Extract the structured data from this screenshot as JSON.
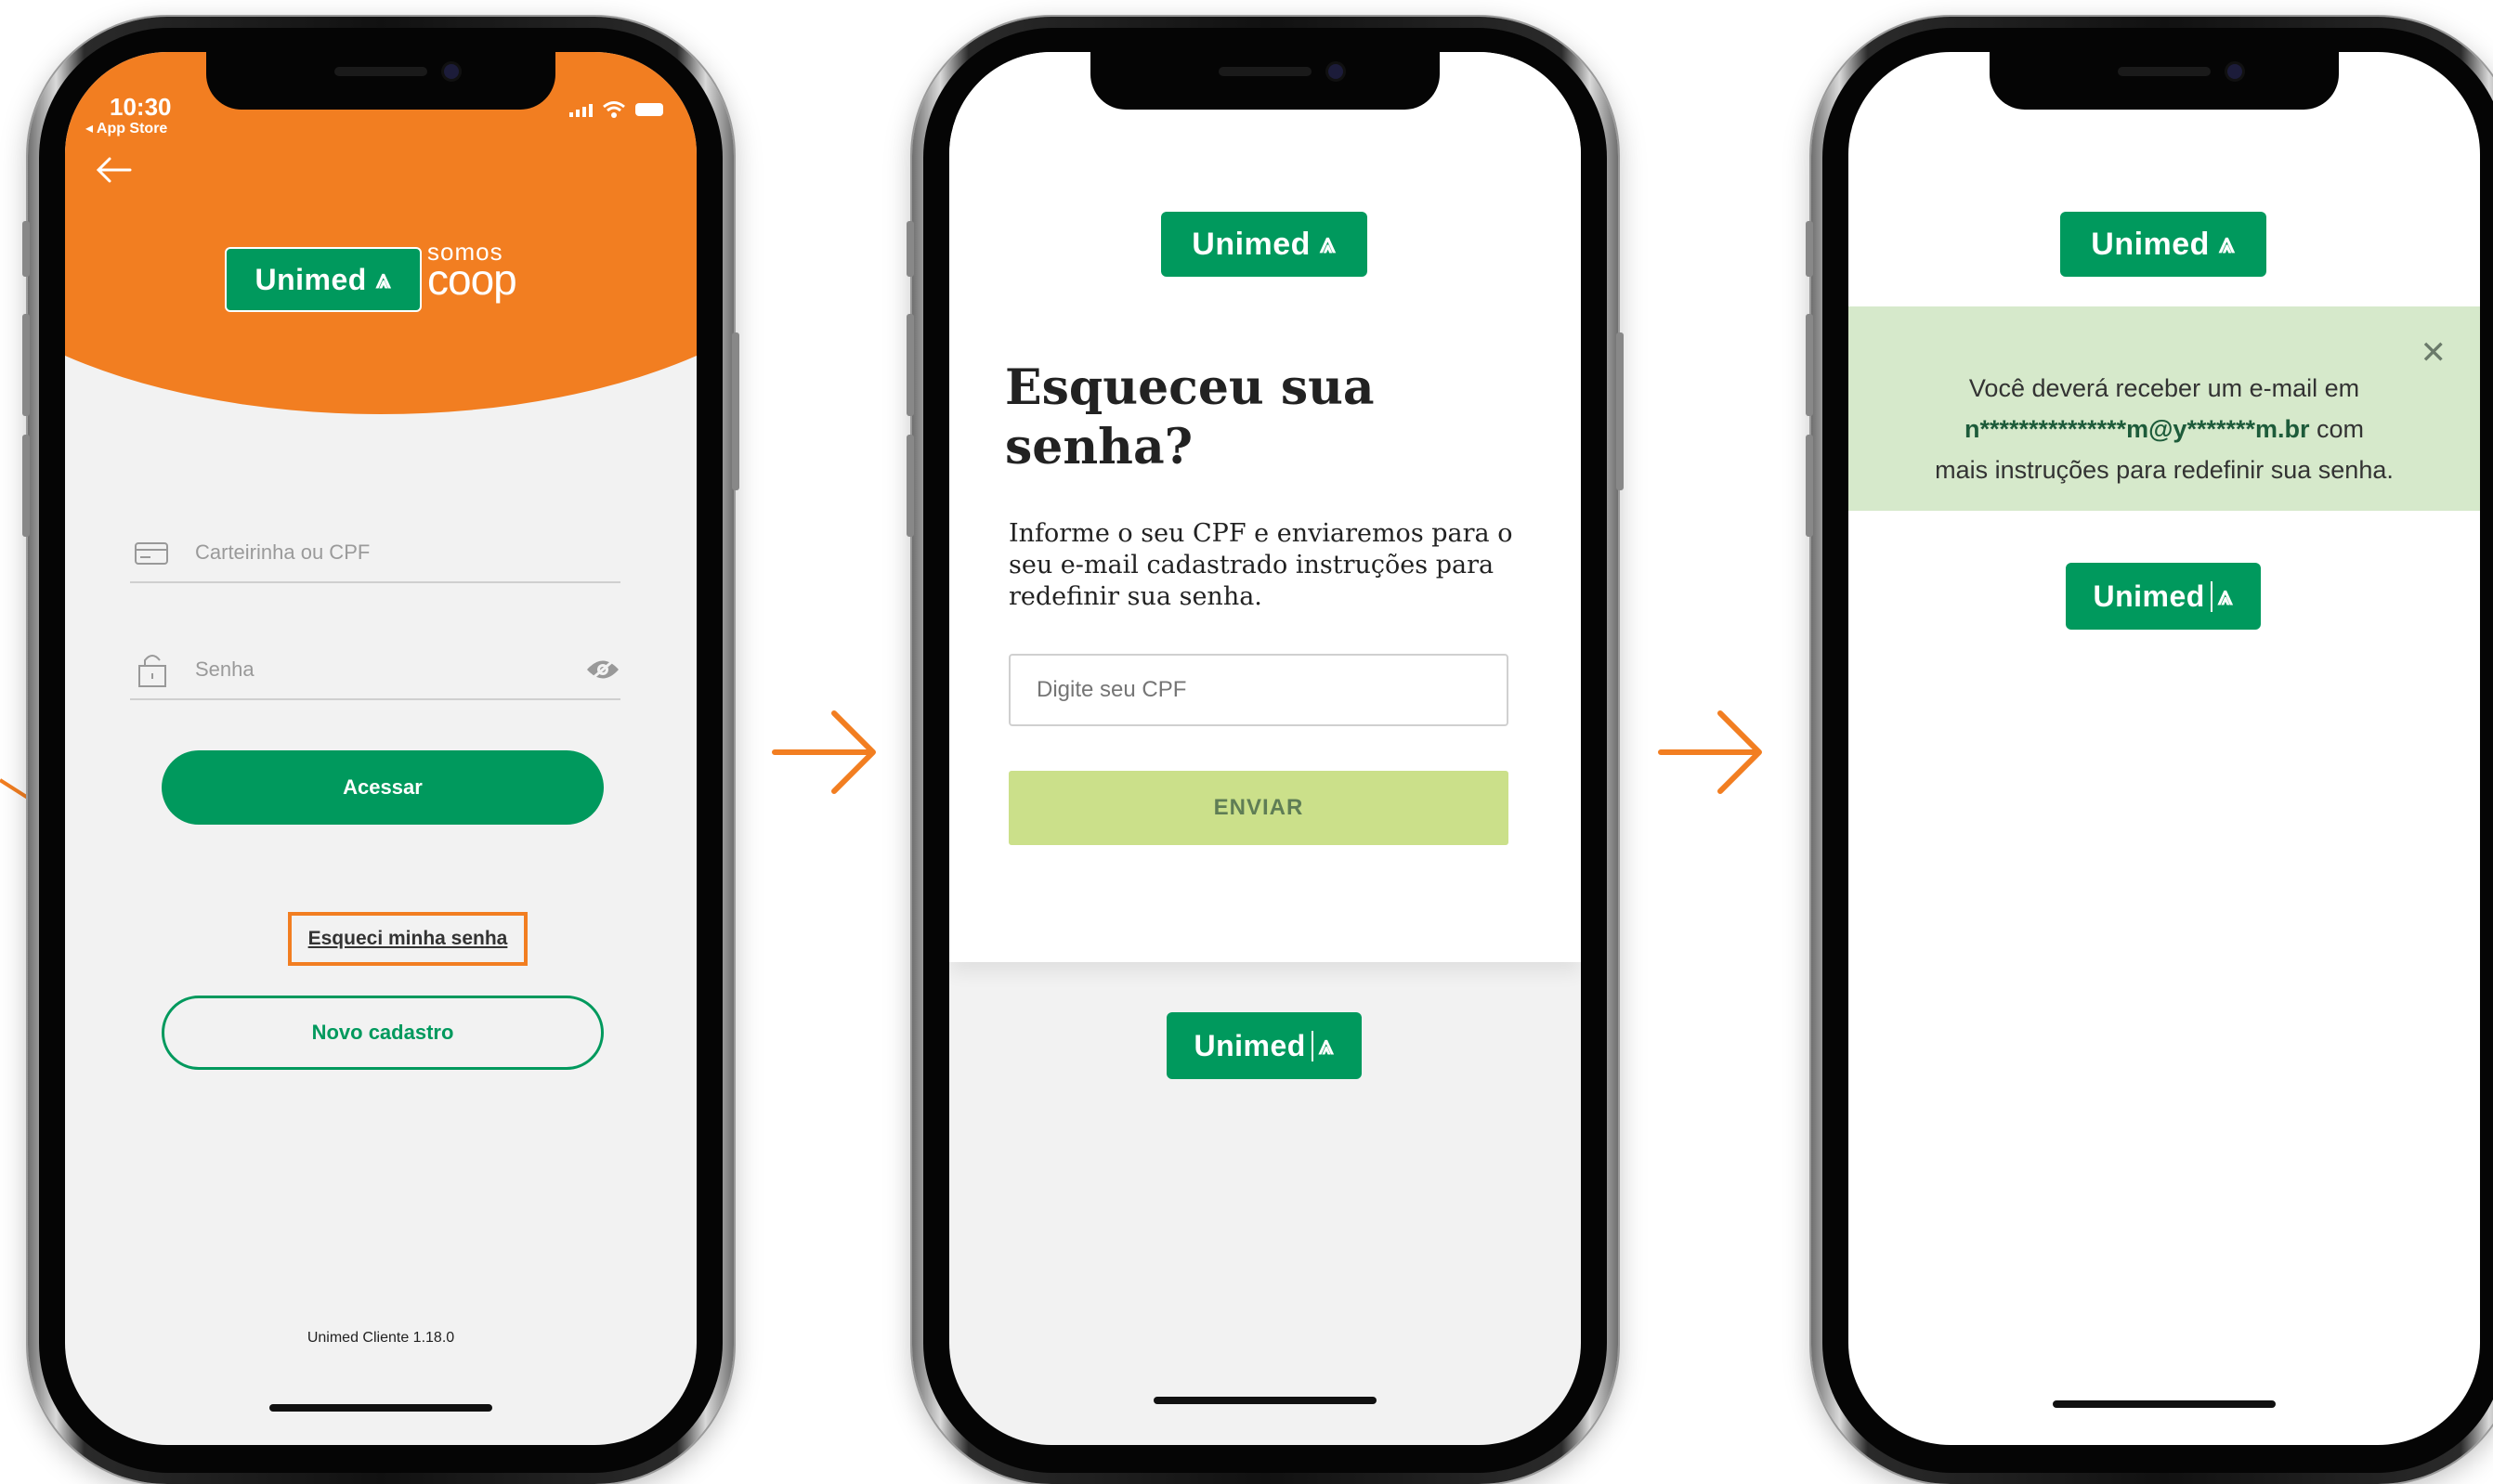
{
  "colors": {
    "brand_green": "#00995d",
    "orange": "#f27e21",
    "disabled_button": "#cbe08a",
    "success_bg": "#d6e9cb"
  },
  "login_screen": {
    "status_time": "10:30",
    "status_back": "◂ App Store",
    "logo_text": "Unimed",
    "somos_top": "somos",
    "somos_bottom": "coop",
    "card_field_placeholder": "Carteirinha ou CPF",
    "password_placeholder": "Senha",
    "access_button": "Acessar",
    "forgot_link": "Esqueci minha senha",
    "register_button": "Novo cadastro",
    "version": "Unimed Cliente 1.18.0"
  },
  "forgot_screen": {
    "logo_text": "Unimed",
    "title": "Esqueceu sua senha?",
    "description": "Informe o seu CPF e enviaremos para o seu e-mail cadastrado instruções para redefinir sua senha.",
    "cpf_placeholder": "Digite seu CPF",
    "send_button": "ENVIAR",
    "footer_logo_text": "Unimed"
  },
  "success_screen": {
    "logo_text": "Unimed",
    "message_line1": "Você deverá receber um e-mail em",
    "masked_email": "n***************m@y*******m.br",
    "message_with": " com",
    "message_line3": "mais instruções para redefinir sua senha.",
    "close_symbol": "✕",
    "footer_logo_text": "Unimed"
  },
  "icons": [
    "back-arrow-icon",
    "card-icon",
    "lock-icon",
    "eye-icon",
    "close-icon",
    "signal-icon",
    "wifi-icon",
    "battery-icon",
    "flow-arrow-icon"
  ]
}
